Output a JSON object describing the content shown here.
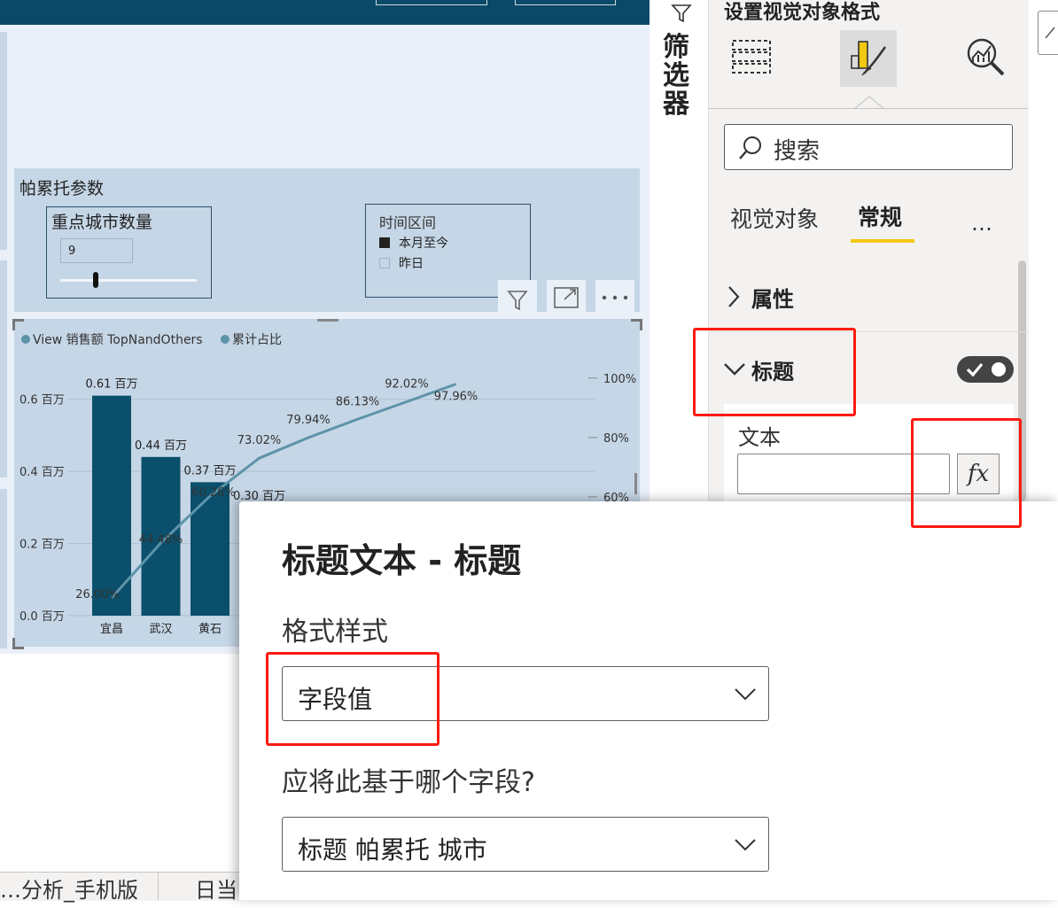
{
  "report": {
    "param_panel_title": "帕累托参数",
    "city_slicer": {
      "title": "重点城市数量",
      "value": "9",
      "slider_fraction": 0.25
    },
    "time_slicer": {
      "title": "时间区间",
      "options": [
        {
          "label": "本月至今",
          "checked": true
        },
        {
          "label": "昨日",
          "checked": false
        }
      ]
    },
    "page_tabs": [
      "…分析_手机版",
      "日当"
    ]
  },
  "chart_data": {
    "type": "bar",
    "legend": [
      "View 销售额 TopNandOthers",
      "累计占比"
    ],
    "categories": [
      "宜昌",
      "武汉",
      "黄石",
      ""
    ],
    "bar_values": [
      0.61,
      0.44,
      0.37,
      0.3
    ],
    "bar_labels": [
      "0.61 百万",
      "0.44 百万",
      "0.37 百万",
      "0.30 百万"
    ],
    "line_values": [
      26.0,
      44.48,
      60.26,
      73.02,
      79.94,
      86.13,
      92.02,
      97.96
    ],
    "line_labels": [
      "26.00%",
      "44.48%",
      "60.26%",
      "73.02%",
      "79.94%",
      "86.13%",
      "92.02%",
      "97.96%"
    ],
    "y_left_ticks": [
      "0.0 百万",
      "0.2 百万",
      "0.4 百万",
      "0.6 百万"
    ],
    "y_right_ticks": [
      "60%",
      "80%",
      "100%"
    ],
    "ylim": [
      0,
      0.7
    ],
    "y2lim": [
      20,
      105
    ],
    "colors": {
      "bar": "#0a4f6b",
      "line": "#5d93a9"
    }
  },
  "filter_strip": {
    "label": "筛选器"
  },
  "format_pane": {
    "title": "设置视觉对象格式",
    "search_placeholder": "搜索",
    "subtabs": {
      "visual": "视觉对象",
      "general": "常规",
      "more": "…"
    },
    "sections": {
      "properties": "属性",
      "title": "标题"
    },
    "title_enabled": true,
    "text_label": "文本",
    "fx_label": "fx"
  },
  "dialog": {
    "title": "标题文本 - 标题",
    "format_style_label": "格式样式",
    "format_style_value": "字段值",
    "field_question": "应将此基于哪个字段?",
    "field_value": "标题 帕累托 城市"
  },
  "colors": {
    "accent": "#f2c811",
    "highlight": "#ff1a10",
    "header": "#0a4a68"
  }
}
